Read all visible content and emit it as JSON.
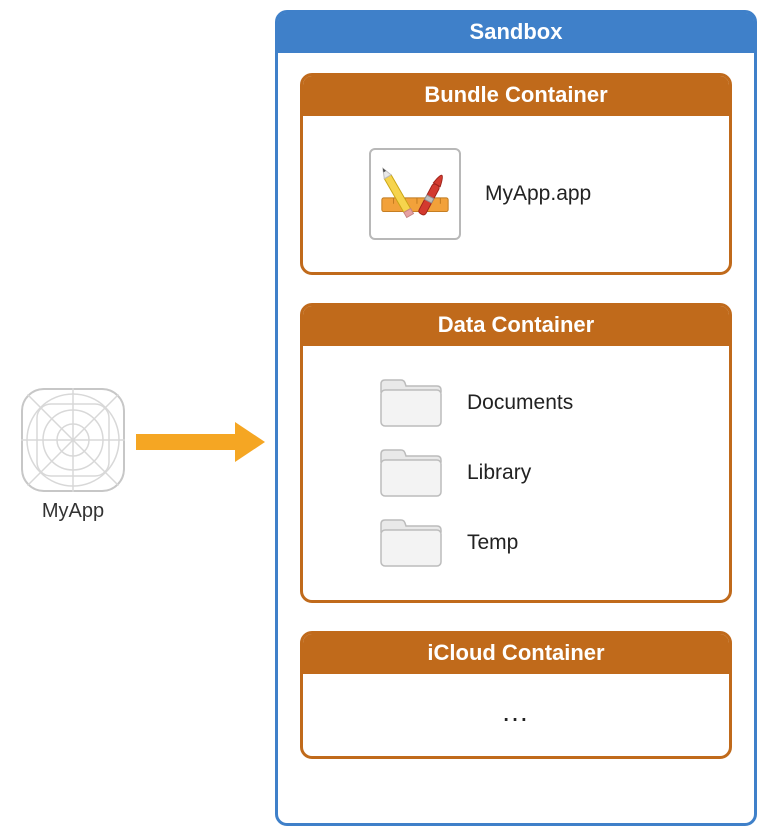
{
  "app": {
    "label": "MyApp"
  },
  "sandbox": {
    "title": "Sandbox",
    "containers": {
      "bundle": {
        "title": "Bundle Container",
        "item_label": "MyApp.app"
      },
      "data": {
        "title": "Data Container",
        "folders": [
          {
            "label": "Documents"
          },
          {
            "label": "Library"
          },
          {
            "label": "Temp"
          }
        ]
      },
      "icloud": {
        "title": "iCloud Container",
        "content": "…"
      }
    }
  }
}
